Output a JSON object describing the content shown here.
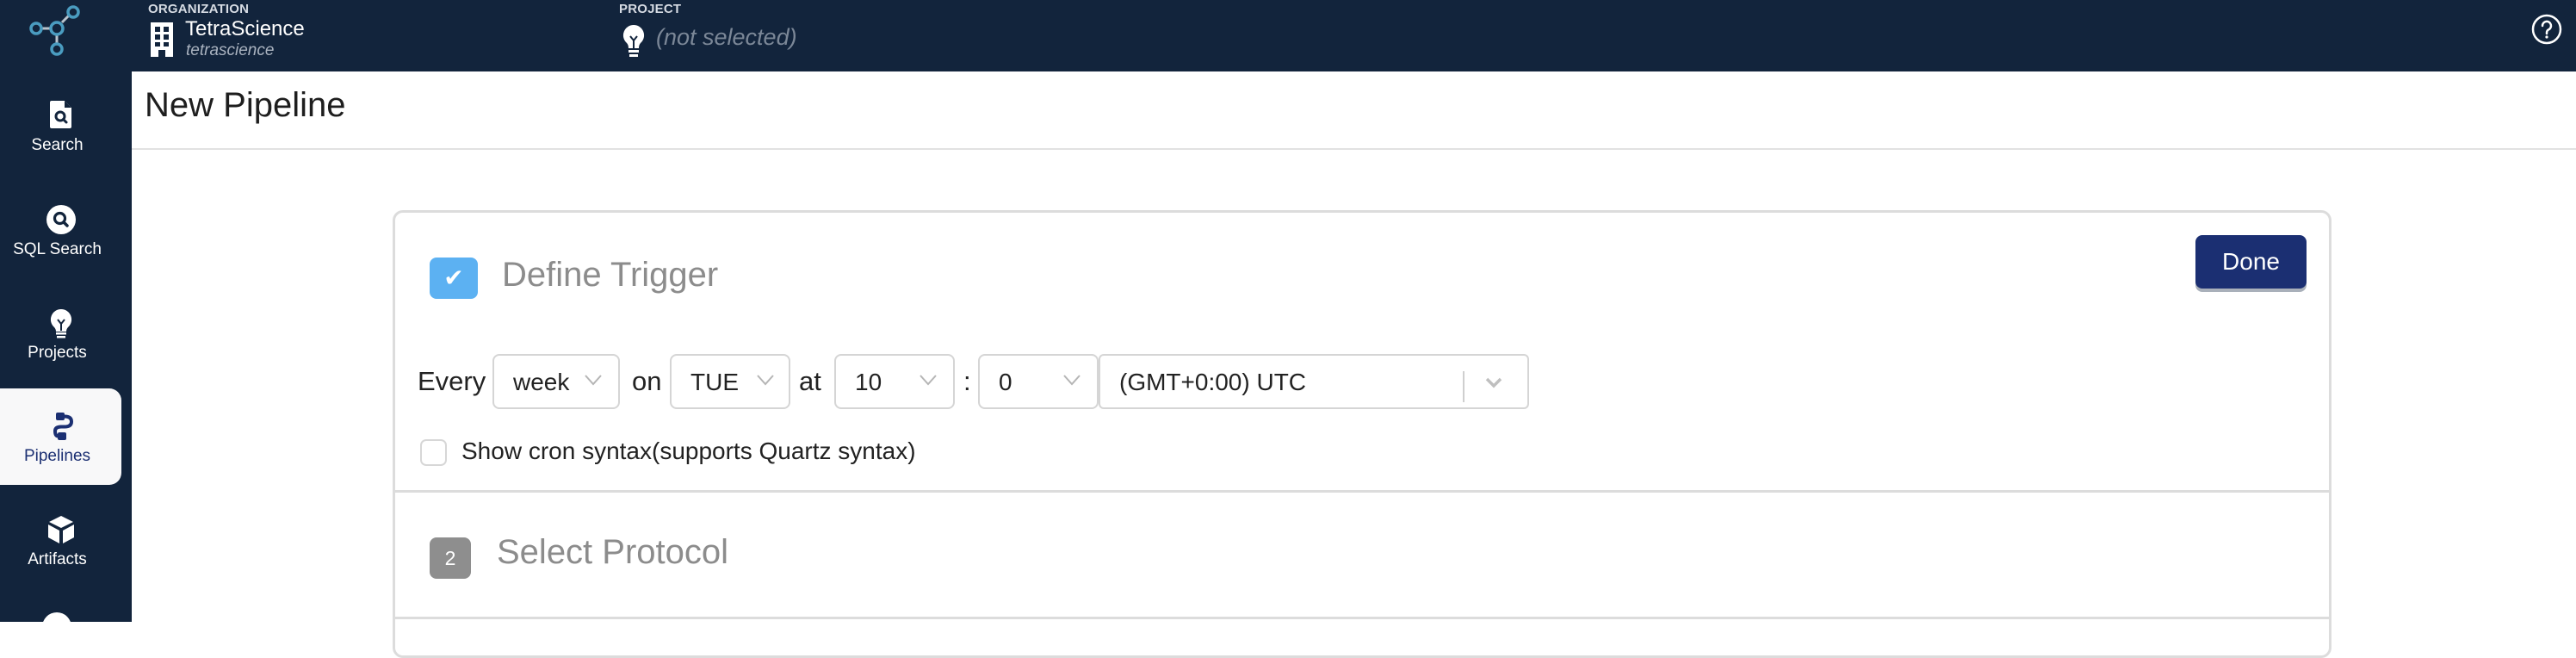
{
  "header": {
    "organization_label": "ORGANIZATION",
    "organization_name": "TetraScience",
    "organization_slug": "tetrascience",
    "project_label": "PROJECT",
    "project_value": "(not selected)",
    "help_icon": "question-circle-icon"
  },
  "sidebar": {
    "logo": "tetrascience-logo",
    "items": [
      {
        "label": "Search",
        "icon": "file-search-icon",
        "active": false
      },
      {
        "label": "SQL Search",
        "icon": "search-circle-icon",
        "active": false
      },
      {
        "label": "Projects",
        "icon": "lightbulb-icon",
        "active": false
      },
      {
        "label": "Pipelines",
        "icon": "pipeline-icon",
        "active": true
      },
      {
        "label": "Artifacts",
        "icon": "cube-icon",
        "active": false
      }
    ]
  },
  "page": {
    "title": "New Pipeline"
  },
  "steps": [
    {
      "badge": "✔",
      "title": "Define Trigger",
      "state": "active",
      "done_label": "Done",
      "trigger": {
        "every_label": "Every",
        "interval": "week",
        "on_label": "on",
        "day": "TUE",
        "at_label": "at",
        "hour": "10",
        "colon": ":",
        "minute": "0",
        "timezone": "(GMT+0:00) UTC"
      },
      "cron_checkbox": {
        "label": "Show cron syntax(supports Quartz syntax)",
        "checked": false
      }
    },
    {
      "badge": "2",
      "title": "Select Protocol",
      "state": "pending"
    }
  ],
  "colors": {
    "nav_bg": "#12243c",
    "primary": "#1b2f72",
    "active_step": "#5cb1f2",
    "pending_step": "#8e8e8e",
    "logo_accent": "#4a9cc0"
  }
}
